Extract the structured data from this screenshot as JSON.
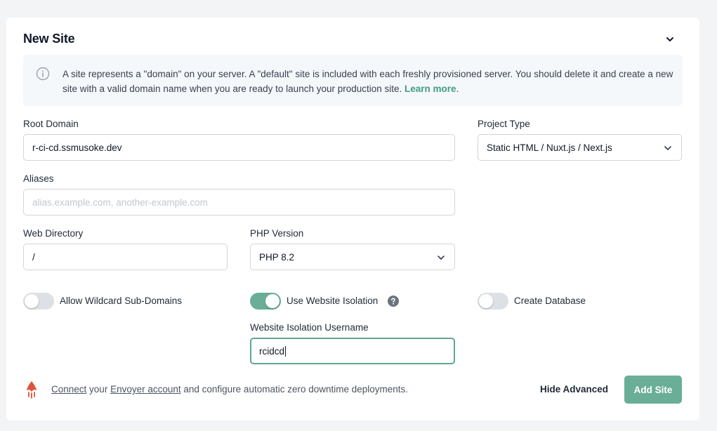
{
  "card": {
    "title": "New Site"
  },
  "notice": {
    "text": "A site represents a \"domain\" on your server. A \"default\" site is included with each freshly provisioned server. You should delete it and create a new site with a valid domain name when you are ready to launch your production site. ",
    "link": "Learn more",
    "suffix": "."
  },
  "fields": {
    "root_domain": {
      "label": "Root Domain",
      "value": "r-ci-cd.ssmusoke.dev"
    },
    "project_type": {
      "label": "Project Type",
      "value": "Static HTML / Nuxt.js / Next.js"
    },
    "aliases": {
      "label": "Aliases",
      "placeholder": "alias.example.com, another-example.com"
    },
    "web_directory": {
      "label": "Web Directory",
      "value": "/"
    },
    "php_version": {
      "label": "PHP Version",
      "value": "PHP 8.2"
    },
    "isolation_username": {
      "label": "Website Isolation Username",
      "value": "rcidcd"
    }
  },
  "toggles": {
    "wildcard": {
      "label": "Allow Wildcard Sub-Domains",
      "on": false
    },
    "isolation": {
      "label": "Use Website Isolation",
      "on": true
    },
    "database": {
      "label": "Create Database",
      "on": false
    }
  },
  "footer": {
    "connect": "Connect",
    "your": " your ",
    "envoyer": "Envoyer account",
    "rest": " and configure automatic zero downtime deployments.",
    "hide_advanced": "Hide Advanced",
    "add_site": "Add Site"
  },
  "colors": {
    "accent": "#6aae97",
    "link": "#3f9d80",
    "envoyer": "#e0533a"
  },
  "icons": {
    "collapse": "chevron-down-icon",
    "info": "info-circle-icon",
    "help": "question-circle-icon",
    "envoyer": "envoyer-rocket-icon"
  }
}
